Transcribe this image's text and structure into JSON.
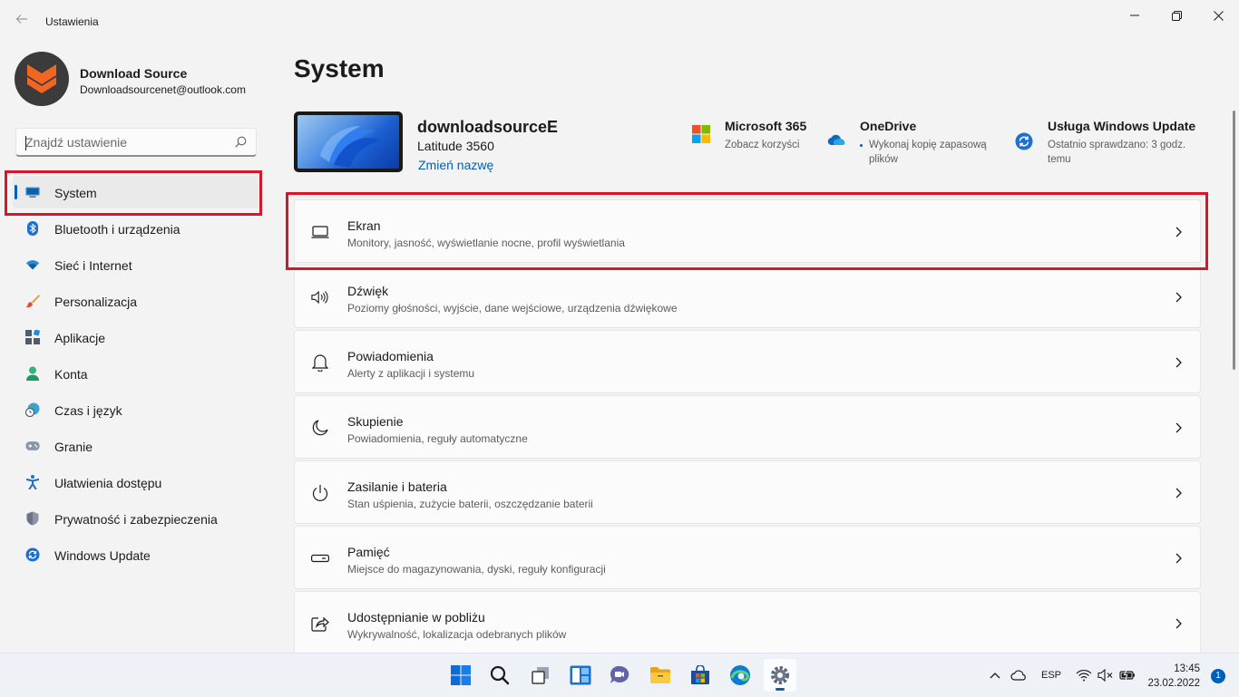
{
  "window": {
    "title": "Ustawienia"
  },
  "profile": {
    "name": "Download Source",
    "email": "Downloadsourcenet@outlook.com"
  },
  "search": {
    "placeholder": "Znajdź ustawienie"
  },
  "sidebar": {
    "items": [
      {
        "label": "System",
        "icon": "system-icon"
      },
      {
        "label": "Bluetooth i urządzenia",
        "icon": "bluetooth-icon"
      },
      {
        "label": "Sieć i Internet",
        "icon": "wifi-icon"
      },
      {
        "label": "Personalizacja",
        "icon": "brush-icon"
      },
      {
        "label": "Aplikacje",
        "icon": "apps-icon"
      },
      {
        "label": "Konta",
        "icon": "account-icon"
      },
      {
        "label": "Czas i język",
        "icon": "clock-globe-icon"
      },
      {
        "label": "Granie",
        "icon": "gamepad-icon"
      },
      {
        "label": "Ułatwienia dostępu",
        "icon": "accessibility-icon"
      },
      {
        "label": "Prywatność i zabezpieczenia",
        "icon": "shield-icon"
      },
      {
        "label": "Windows Update",
        "icon": "update-icon"
      }
    ]
  },
  "main": {
    "title": "System",
    "device": {
      "name": "downloadsourceE",
      "model": "Latitude 3560",
      "rename": "Zmień nazwę"
    },
    "info": [
      {
        "title": "Microsoft 365",
        "sub": "Zobacz korzyści",
        "icon": "microsoft-logo-icon"
      },
      {
        "title": "OneDrive",
        "sub": "Wykonaj kopię zapasową plików",
        "icon": "onedrive-icon"
      },
      {
        "title": "Usługa Windows Update",
        "sub": "Ostatnio sprawdzano: 3 godz. temu",
        "icon": "windows-update-icon"
      }
    ],
    "cards": [
      {
        "title": "Ekran",
        "sub": "Monitory, jasność, wyświetlanie nocne, profil wyświetlania",
        "icon": "display-icon"
      },
      {
        "title": "Dźwięk",
        "sub": "Poziomy głośności, wyjście, dane wejściowe, urządzenia dźwiękowe",
        "icon": "speaker-icon"
      },
      {
        "title": "Powiadomienia",
        "sub": "Alerty z aplikacji i systemu",
        "icon": "bell-icon"
      },
      {
        "title": "Skupienie",
        "sub": "Powiadomienia, reguły automatyczne",
        "icon": "moon-icon"
      },
      {
        "title": "Zasilanie i bateria",
        "sub": "Stan uśpienia, zużycie baterii, oszczędzanie baterii",
        "icon": "power-icon"
      },
      {
        "title": "Pamięć",
        "sub": "Miejsce do magazynowania, dyski, reguły konfiguracji",
        "icon": "storage-icon"
      },
      {
        "title": "Udostępnianie w pobliżu",
        "sub": "Wykrywalność, lokalizacja odebranych plików",
        "icon": "share-icon"
      }
    ]
  },
  "taskbar": {
    "language": "ESP",
    "time": "13:45",
    "date": "23.02.2022",
    "notifications": "1"
  },
  "colors": {
    "accent": "#005fb8",
    "highlight": "#d6172a"
  }
}
